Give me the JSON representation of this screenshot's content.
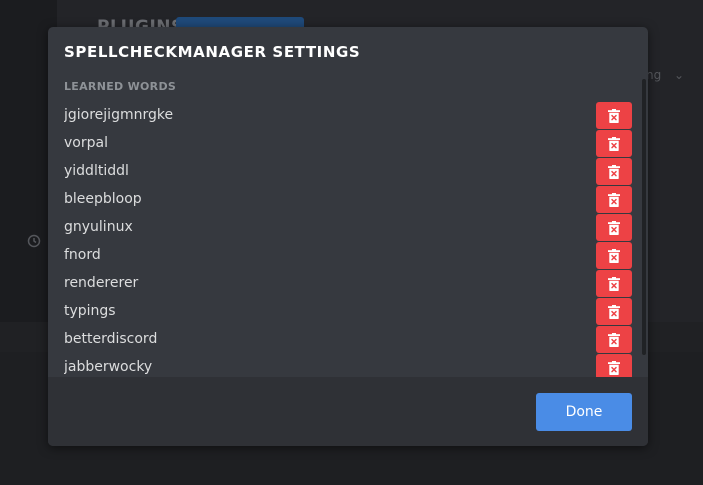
{
  "background": {
    "title": "PLUGINS",
    "sort_label": "ng"
  },
  "modal": {
    "title": "SPELLCHECKMANAGER SETTINGS",
    "section_label": "LEARNED WORDS",
    "words": [
      "jgiorejigmnrgke",
      "vorpal",
      "yiddltiddl",
      "bleepbloop",
      "gnyulinux",
      "fnord",
      "rendererer",
      "typings",
      "betterdiscord",
      "jabberwocky"
    ],
    "delete_icon": "trash-icon",
    "done_label": "Done"
  },
  "colors": {
    "modal_bg": "#36393f",
    "footer_bg": "#2f3136",
    "delete": "#ed4245",
    "done": "#4a8ce6"
  }
}
